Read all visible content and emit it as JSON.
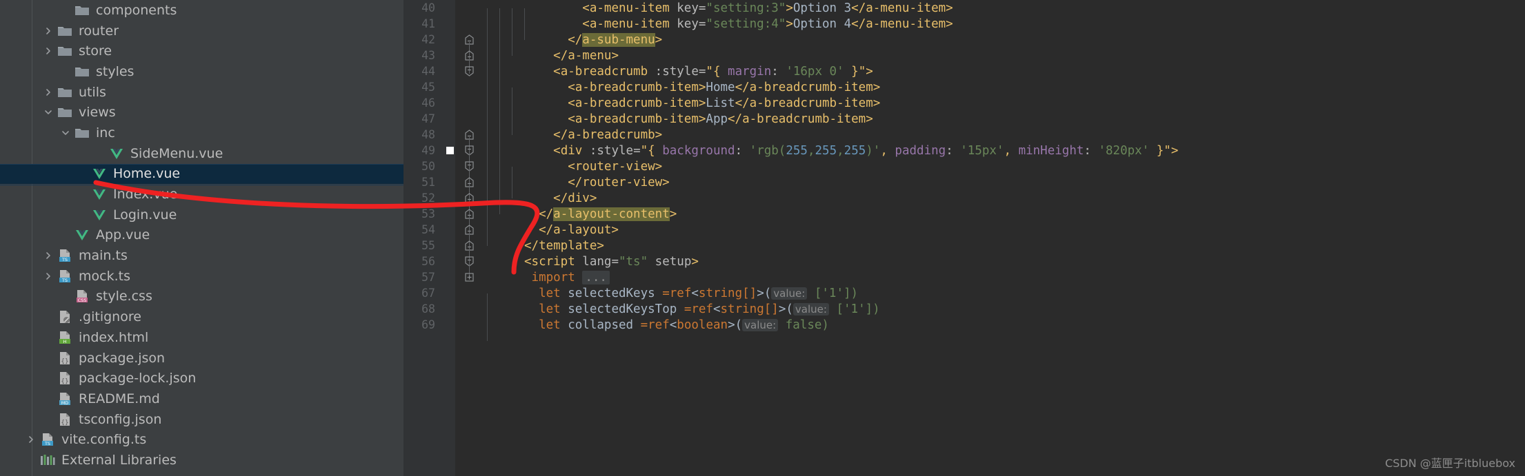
{
  "sidebar": {
    "items": [
      {
        "label": "components",
        "indent": 3,
        "chevron": "none",
        "icon": "folder-icon"
      },
      {
        "label": "router",
        "indent": 2,
        "chevron": "right",
        "icon": "folder-icon"
      },
      {
        "label": "store",
        "indent": 2,
        "chevron": "right",
        "icon": "folder-icon"
      },
      {
        "label": "styles",
        "indent": 3,
        "chevron": "none",
        "icon": "folder-icon"
      },
      {
        "label": "utils",
        "indent": 2,
        "chevron": "right",
        "icon": "folder-icon"
      },
      {
        "label": "views",
        "indent": 2,
        "chevron": "down",
        "icon": "folder-icon"
      },
      {
        "label": "inc",
        "indent": 3,
        "chevron": "down",
        "icon": "folder-icon"
      },
      {
        "label": "SideMenu.vue",
        "indent": 5,
        "chevron": "none",
        "icon": "vue-icon"
      },
      {
        "label": "Home.vue",
        "indent": 4,
        "chevron": "none",
        "icon": "vue-icon",
        "selected": true
      },
      {
        "label": "Index.vue",
        "indent": 4,
        "chevron": "none",
        "icon": "vue-icon"
      },
      {
        "label": "Login.vue",
        "indent": 4,
        "chevron": "none",
        "icon": "vue-icon"
      },
      {
        "label": "App.vue",
        "indent": 3,
        "chevron": "none",
        "icon": "vue-icon"
      },
      {
        "label": "main.ts",
        "indent": 2,
        "chevron": "right",
        "icon": "ts-file-icon"
      },
      {
        "label": "mock.ts",
        "indent": 2,
        "chevron": "right",
        "icon": "ts-file-icon"
      },
      {
        "label": "style.css",
        "indent": 3,
        "chevron": "none",
        "icon": "css-file-icon"
      },
      {
        "label": ".gitignore",
        "indent": 2,
        "chevron": "none",
        "icon": "gitignore-file-icon"
      },
      {
        "label": "index.html",
        "indent": 2,
        "chevron": "none",
        "icon": "html-file-icon"
      },
      {
        "label": "package.json",
        "indent": 2,
        "chevron": "none",
        "icon": "json-file-icon"
      },
      {
        "label": "package-lock.json",
        "indent": 2,
        "chevron": "none",
        "icon": "json-file-icon"
      },
      {
        "label": "README.md",
        "indent": 2,
        "chevron": "none",
        "icon": "md-file-icon"
      },
      {
        "label": "tsconfig.json",
        "indent": 2,
        "chevron": "none",
        "icon": "json-file-icon"
      },
      {
        "label": "vite.config.ts",
        "indent": 1,
        "chevron": "right",
        "icon": "ts-file-icon"
      },
      {
        "label": "External Libraries",
        "indent": 1,
        "chevron": "none",
        "icon": "external-libraries-icon"
      }
    ]
  },
  "editor": {
    "lines": [
      {
        "num": "40",
        "fold": "none",
        "breakpoint": false,
        "guides": 4
      },
      {
        "num": "41",
        "fold": "none",
        "breakpoint": false,
        "guides": 4
      },
      {
        "num": "42",
        "fold": "end",
        "breakpoint": false,
        "guides": 3
      },
      {
        "num": "43",
        "fold": "end",
        "breakpoint": false,
        "guides": 2
      },
      {
        "num": "44",
        "fold": "start",
        "breakpoint": false,
        "guides": 2
      },
      {
        "num": "45",
        "fold": "none",
        "breakpoint": false,
        "guides": 3
      },
      {
        "num": "46",
        "fold": "none",
        "breakpoint": false,
        "guides": 3
      },
      {
        "num": "47",
        "fold": "none",
        "breakpoint": false,
        "guides": 3
      },
      {
        "num": "48",
        "fold": "end",
        "breakpoint": false,
        "guides": 2
      },
      {
        "num": "49",
        "fold": "start",
        "breakpoint": true,
        "guides": 2
      },
      {
        "num": "50",
        "fold": "start",
        "breakpoint": false,
        "guides": 3
      },
      {
        "num": "51",
        "fold": "end",
        "breakpoint": false,
        "guides": 3
      },
      {
        "num": "52",
        "fold": "end",
        "breakpoint": false,
        "guides": 2
      },
      {
        "num": "53",
        "fold": "end",
        "breakpoint": false,
        "guides": 1
      },
      {
        "num": "54",
        "fold": "end",
        "breakpoint": false,
        "guides": 1
      },
      {
        "num": "55",
        "fold": "end",
        "breakpoint": false,
        "guides": 0
      },
      {
        "num": "56",
        "fold": "start",
        "breakpoint": false,
        "guides": 0
      },
      {
        "num": "57",
        "fold": "plus",
        "breakpoint": false,
        "guides": 0
      },
      {
        "num": "67",
        "fold": "none",
        "breakpoint": false,
        "guides": 1
      },
      {
        "num": "68",
        "fold": "none",
        "breakpoint": false,
        "guides": 1
      },
      {
        "num": "69",
        "fold": "none",
        "breakpoint": false,
        "guides": 1
      }
    ],
    "code": {
      "l40": {
        "indent": "        ",
        "tag_open": "<a-menu-item",
        "attr": " key=",
        "str": "\"setting:3\"",
        "gt": ">",
        "text": "Option 3",
        "tag_close": "</a-menu-item>"
      },
      "l41": {
        "indent": "        ",
        "tag_open": "<a-menu-item",
        "attr": " key=",
        "str": "\"setting:4\"",
        "gt": ">",
        "text": "Option 4",
        "tag_close": "</a-menu-item>"
      },
      "l42": {
        "indent": "      ",
        "prefix": "</",
        "highlight": "a-sub-menu",
        "suffix": ">"
      },
      "l43": {
        "indent": "    ",
        "text": "</a-menu>"
      },
      "l44": {
        "indent": "    ",
        "tag": "<a-breadcrumb",
        "attr": " :style=",
        "q1": "\"{ ",
        "prop": "margin",
        "colon": ": ",
        "val": "'16px 0'",
        "close": " }\">"
      },
      "l45": {
        "indent": "      ",
        "open": "<a-breadcrumb-item>",
        "text": "Home",
        "close": "</a-breadcrumb-item>"
      },
      "l46": {
        "indent": "      ",
        "open": "<a-breadcrumb-item>",
        "text": "List",
        "close": "</a-breadcrumb-item>"
      },
      "l47": {
        "indent": "      ",
        "open": "<a-breadcrumb-item>",
        "text": "App",
        "close": "</a-breadcrumb-item>"
      },
      "l48": {
        "indent": "    ",
        "text": "</a-breadcrumb>"
      },
      "l49": {
        "indent": "    ",
        "tag": "<div",
        "attr": " :style=",
        "q1": "\"{ ",
        "p1": "background",
        "c1": ": ",
        "v1a": "'rgb(",
        "n1": "255",
        "cm1": ",",
        "n2": "255",
        "cm2": ",",
        "n3": "255",
        "v1b": ")'",
        "cm3": ", ",
        "p2": "padding",
        "c2": ": ",
        "v2": "'15px'",
        "cm4": ", ",
        "p3": "minHeight",
        "c3": ": ",
        "v3": "'820px'",
        "close": " }\">"
      },
      "l50": {
        "indent": "      ",
        "text": "<router-view>"
      },
      "l51": {
        "indent": "      ",
        "text": "</router-view>"
      },
      "l52": {
        "indent": "    ",
        "text": "</div>"
      },
      "l53": {
        "indent": "  ",
        "prefix": "</",
        "highlight": "a-layout-content",
        "suffix": ">"
      },
      "l54": {
        "indent": "  ",
        "text": "</a-layout>"
      },
      "l55": {
        "indent": "",
        "text": "</template>"
      },
      "l56": {
        "indent": "",
        "tag": "<script",
        "attr": " lang=",
        "str": "\"ts\"",
        "attr2": " setup",
        "gt": ">"
      },
      "l57": {
        "indent": " ",
        "kw": "import",
        "dots": "..."
      },
      "l67": {
        "indent": "  ",
        "kw": "let",
        "name": " selectedKeys ",
        "eq": "=",
        "ref": "ref",
        "lt": "<",
        "type": "string[]",
        "gt": ">(",
        "hint": "value:",
        "val": " ['1'])"
      },
      "l68": {
        "indent": "  ",
        "kw": "let",
        "name": " selectedKeysTop ",
        "eq": "=",
        "ref": "ref",
        "lt": "<",
        "type": "string[]",
        "gt": ">(",
        "hint": "value:",
        "val": " ['1'])"
      },
      "l69": {
        "indent": "  ",
        "kw": "let",
        "name": " collapsed ",
        "eq": "=",
        "ref": "ref",
        "lt": "<",
        "type": "boolean",
        "gt": ">(",
        "hint": "value:",
        "val": " false)"
      }
    }
  },
  "watermark": {
    "text": "CSDN @蓝匣子itbluebox"
  },
  "annotation": {
    "color": "#ee2222",
    "name": "red-arrow-annotation"
  },
  "colors": {
    "sidebar_bg": "#3c3f41",
    "editor_bg": "#2b2b2b",
    "gutter_bg": "#313335",
    "selection_bg": "#0d293e",
    "tag_color": "#e8bf6a",
    "string_color": "#6a8759",
    "keyword_color": "#cc7832",
    "number_color": "#6897bb",
    "highlight_bg": "#6b6b38"
  }
}
